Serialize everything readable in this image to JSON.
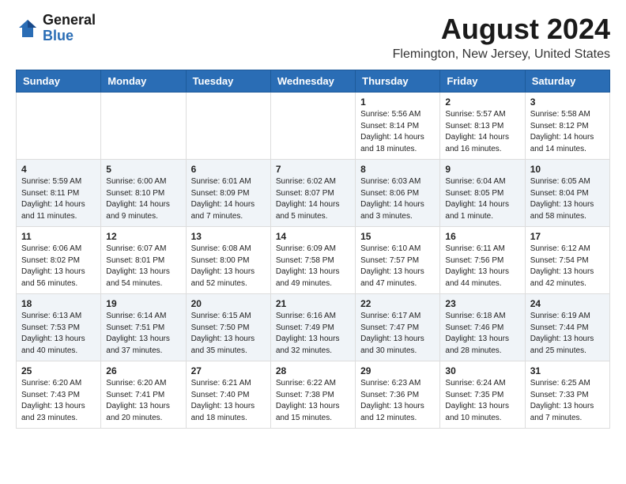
{
  "header": {
    "logo_general": "General",
    "logo_blue": "Blue",
    "title": "August 2024",
    "subtitle": "Flemington, New Jersey, United States"
  },
  "weekdays": [
    "Sunday",
    "Monday",
    "Tuesday",
    "Wednesday",
    "Thursday",
    "Friday",
    "Saturday"
  ],
  "weeks": [
    [
      {
        "day": "",
        "info": ""
      },
      {
        "day": "",
        "info": ""
      },
      {
        "day": "",
        "info": ""
      },
      {
        "day": "",
        "info": ""
      },
      {
        "day": "1",
        "info": "Sunrise: 5:56 AM\nSunset: 8:14 PM\nDaylight: 14 hours\nand 18 minutes."
      },
      {
        "day": "2",
        "info": "Sunrise: 5:57 AM\nSunset: 8:13 PM\nDaylight: 14 hours\nand 16 minutes."
      },
      {
        "day": "3",
        "info": "Sunrise: 5:58 AM\nSunset: 8:12 PM\nDaylight: 14 hours\nand 14 minutes."
      }
    ],
    [
      {
        "day": "4",
        "info": "Sunrise: 5:59 AM\nSunset: 8:11 PM\nDaylight: 14 hours\nand 11 minutes."
      },
      {
        "day": "5",
        "info": "Sunrise: 6:00 AM\nSunset: 8:10 PM\nDaylight: 14 hours\nand 9 minutes."
      },
      {
        "day": "6",
        "info": "Sunrise: 6:01 AM\nSunset: 8:09 PM\nDaylight: 14 hours\nand 7 minutes."
      },
      {
        "day": "7",
        "info": "Sunrise: 6:02 AM\nSunset: 8:07 PM\nDaylight: 14 hours\nand 5 minutes."
      },
      {
        "day": "8",
        "info": "Sunrise: 6:03 AM\nSunset: 8:06 PM\nDaylight: 14 hours\nand 3 minutes."
      },
      {
        "day": "9",
        "info": "Sunrise: 6:04 AM\nSunset: 8:05 PM\nDaylight: 14 hours\nand 1 minute."
      },
      {
        "day": "10",
        "info": "Sunrise: 6:05 AM\nSunset: 8:04 PM\nDaylight: 13 hours\nand 58 minutes."
      }
    ],
    [
      {
        "day": "11",
        "info": "Sunrise: 6:06 AM\nSunset: 8:02 PM\nDaylight: 13 hours\nand 56 minutes."
      },
      {
        "day": "12",
        "info": "Sunrise: 6:07 AM\nSunset: 8:01 PM\nDaylight: 13 hours\nand 54 minutes."
      },
      {
        "day": "13",
        "info": "Sunrise: 6:08 AM\nSunset: 8:00 PM\nDaylight: 13 hours\nand 52 minutes."
      },
      {
        "day": "14",
        "info": "Sunrise: 6:09 AM\nSunset: 7:58 PM\nDaylight: 13 hours\nand 49 minutes."
      },
      {
        "day": "15",
        "info": "Sunrise: 6:10 AM\nSunset: 7:57 PM\nDaylight: 13 hours\nand 47 minutes."
      },
      {
        "day": "16",
        "info": "Sunrise: 6:11 AM\nSunset: 7:56 PM\nDaylight: 13 hours\nand 44 minutes."
      },
      {
        "day": "17",
        "info": "Sunrise: 6:12 AM\nSunset: 7:54 PM\nDaylight: 13 hours\nand 42 minutes."
      }
    ],
    [
      {
        "day": "18",
        "info": "Sunrise: 6:13 AM\nSunset: 7:53 PM\nDaylight: 13 hours\nand 40 minutes."
      },
      {
        "day": "19",
        "info": "Sunrise: 6:14 AM\nSunset: 7:51 PM\nDaylight: 13 hours\nand 37 minutes."
      },
      {
        "day": "20",
        "info": "Sunrise: 6:15 AM\nSunset: 7:50 PM\nDaylight: 13 hours\nand 35 minutes."
      },
      {
        "day": "21",
        "info": "Sunrise: 6:16 AM\nSunset: 7:49 PM\nDaylight: 13 hours\nand 32 minutes."
      },
      {
        "day": "22",
        "info": "Sunrise: 6:17 AM\nSunset: 7:47 PM\nDaylight: 13 hours\nand 30 minutes."
      },
      {
        "day": "23",
        "info": "Sunrise: 6:18 AM\nSunset: 7:46 PM\nDaylight: 13 hours\nand 28 minutes."
      },
      {
        "day": "24",
        "info": "Sunrise: 6:19 AM\nSunset: 7:44 PM\nDaylight: 13 hours\nand 25 minutes."
      }
    ],
    [
      {
        "day": "25",
        "info": "Sunrise: 6:20 AM\nSunset: 7:43 PM\nDaylight: 13 hours\nand 23 minutes."
      },
      {
        "day": "26",
        "info": "Sunrise: 6:20 AM\nSunset: 7:41 PM\nDaylight: 13 hours\nand 20 minutes."
      },
      {
        "day": "27",
        "info": "Sunrise: 6:21 AM\nSunset: 7:40 PM\nDaylight: 13 hours\nand 18 minutes."
      },
      {
        "day": "28",
        "info": "Sunrise: 6:22 AM\nSunset: 7:38 PM\nDaylight: 13 hours\nand 15 minutes."
      },
      {
        "day": "29",
        "info": "Sunrise: 6:23 AM\nSunset: 7:36 PM\nDaylight: 13 hours\nand 12 minutes."
      },
      {
        "day": "30",
        "info": "Sunrise: 6:24 AM\nSunset: 7:35 PM\nDaylight: 13 hours\nand 10 minutes."
      },
      {
        "day": "31",
        "info": "Sunrise: 6:25 AM\nSunset: 7:33 PM\nDaylight: 13 hours\nand 7 minutes."
      }
    ]
  ]
}
